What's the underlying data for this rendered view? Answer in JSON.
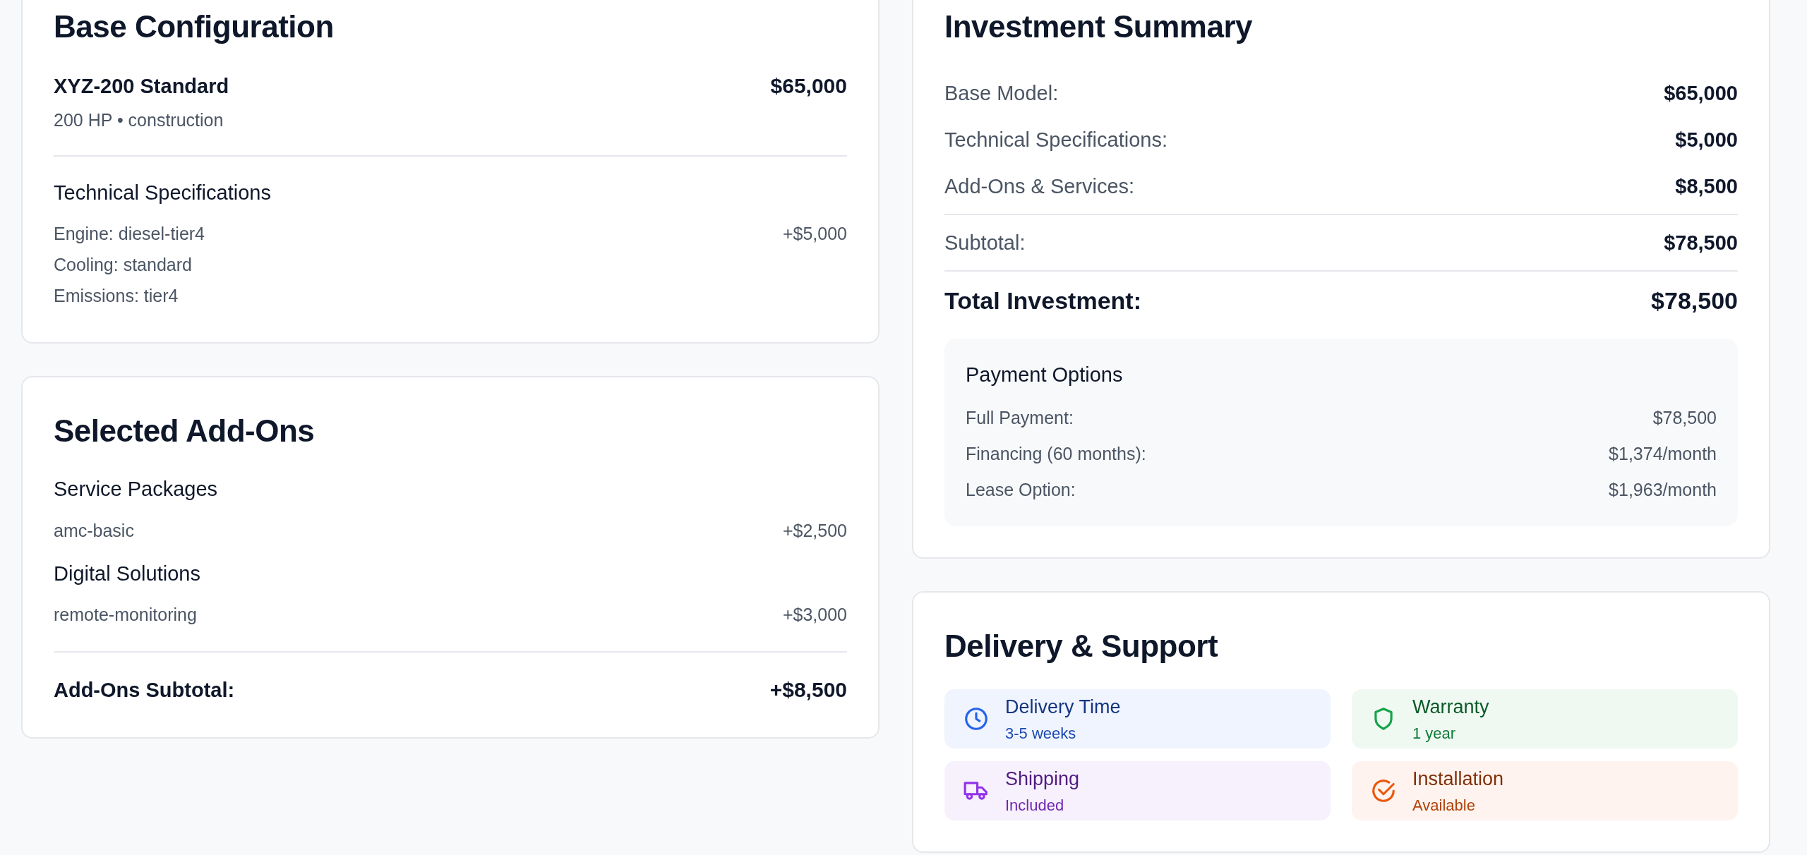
{
  "base_configuration": {
    "title": "Base Configuration",
    "model": {
      "name": "XYZ-200 Standard",
      "details": "200 HP • construction",
      "price": "$65,000"
    },
    "specs_title": "Technical Specifications",
    "specs": [
      {
        "label": "Engine: diesel-tier4",
        "price": "+$5,000"
      },
      {
        "label": "Cooling: standard"
      },
      {
        "label": "Emissions: tier4"
      }
    ]
  },
  "selected_add_ons": {
    "title": "Selected Add-Ons",
    "groups": [
      {
        "title": "Service Packages",
        "items": [
          {
            "name": "amc-basic",
            "price": "+$2,500"
          }
        ]
      },
      {
        "title": "Digital Solutions",
        "items": [
          {
            "name": "remote-monitoring",
            "price": "+$3,000"
          }
        ]
      }
    ],
    "subtotal": {
      "label": "Add-Ons Subtotal:",
      "value": "+$8,500"
    }
  },
  "investment_summary": {
    "title": "Investment Summary",
    "lines": [
      {
        "label": "Base Model:",
        "value": "$65,000"
      },
      {
        "label": "Technical Specifications:",
        "value": "$5,000"
      },
      {
        "label": "Add-Ons & Services:",
        "value": "$8,500"
      }
    ],
    "subtotal": {
      "label": "Subtotal:",
      "value": "$78,500"
    },
    "total": {
      "label": "Total Investment:",
      "value": "$78,500"
    },
    "payment_options": {
      "title": "Payment Options",
      "options": [
        {
          "label": "Full Payment:",
          "value": "$78,500"
        },
        {
          "label": "Financing (60 months):",
          "value": "$1,374/month"
        },
        {
          "label": "Lease Option:",
          "value": "$1,963/month"
        }
      ]
    }
  },
  "delivery_support": {
    "title": "Delivery & Support",
    "tiles": [
      {
        "kind": "clock",
        "title": "Delivery Time",
        "value": "3-5 weeks",
        "color": "#2563eb"
      },
      {
        "kind": "shield",
        "title": "Warranty",
        "value": "1 year",
        "color": "#16a34a"
      },
      {
        "kind": "truck",
        "title": "Shipping",
        "value": "Included",
        "color": "#9333ea"
      },
      {
        "kind": "check",
        "title": "Installation",
        "value": "Available",
        "color": "#ea580c"
      }
    ]
  }
}
